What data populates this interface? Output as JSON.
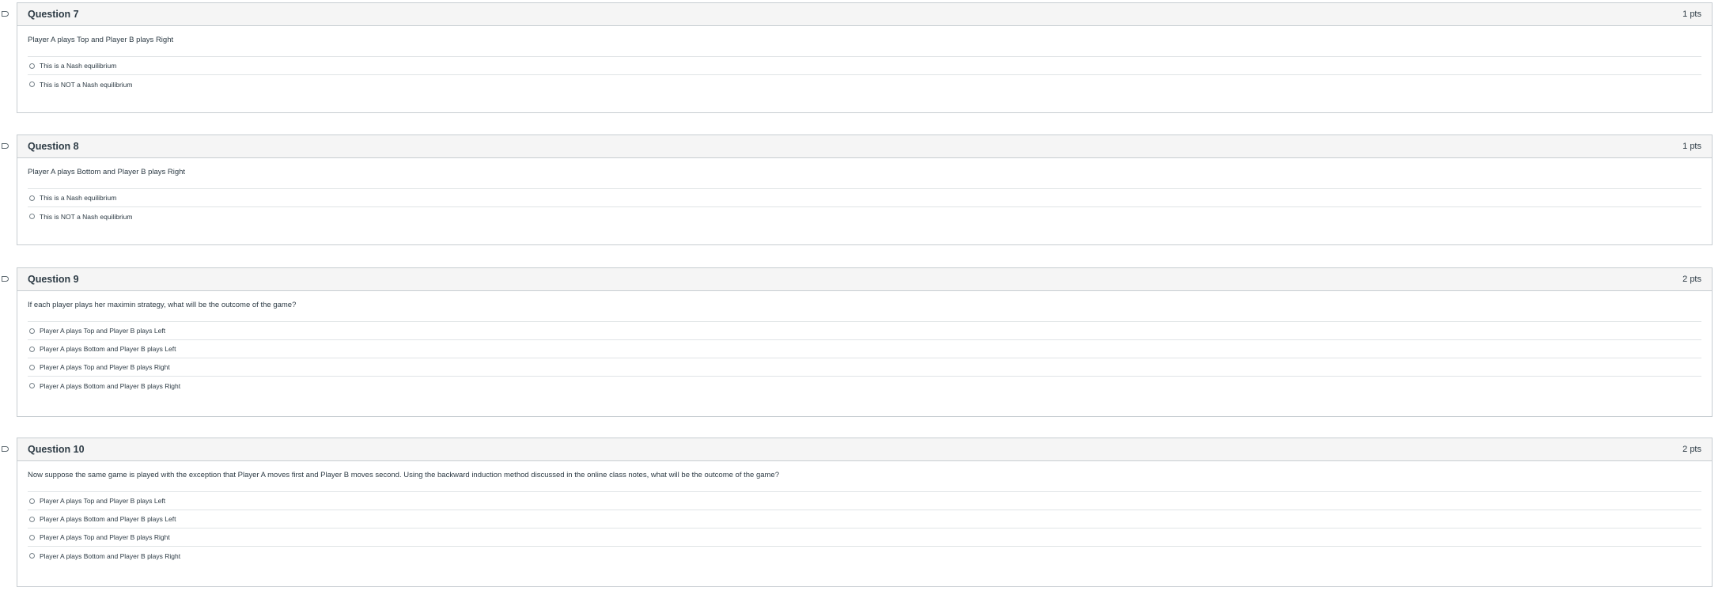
{
  "questions": [
    {
      "title": "Question 7",
      "points": "1 pts",
      "text": "Player A plays Top and Player B plays Right",
      "answers": [
        "This is a Nash equilibrium",
        "This is NOT a Nash equilibrium"
      ]
    },
    {
      "title": "Question 8",
      "points": "1 pts",
      "text": "Player A plays Bottom and Player B plays Right",
      "answers": [
        "This is a Nash equilibrium",
        "This is NOT a Nash equilibrium"
      ]
    },
    {
      "title": "Question 9",
      "points": "2 pts",
      "text": "If each player plays her maximin strategy, what will be the outcome of the game?",
      "answers": [
        "Player A plays Top and Player B plays Left",
        "Player A plays Bottom and Player B plays Left",
        "Player A plays Top and Player B plays Right",
        "Player A plays Bottom and Player B plays Right"
      ]
    },
    {
      "title": "Question 10",
      "points": "2 pts",
      "text": "Now suppose the same game is played with the exception that Player A moves first and Player B moves second. Using the backward induction method discussed in the online class notes, what will be the outcome of the game?",
      "answers": [
        "Player A plays Top and Player B plays Left",
        "Player A plays Bottom and Player B plays Left",
        "Player A plays Top and Player B plays Right",
        "Player A plays Bottom and Player B plays Right"
      ]
    }
  ]
}
